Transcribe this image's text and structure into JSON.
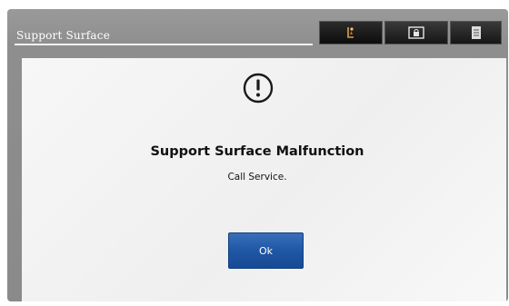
{
  "dialog": {
    "title": "Support Surface",
    "heading": "Support Surface Malfunction",
    "message": "Call Service.",
    "ok_label": "Ok"
  },
  "tabs": [
    {
      "icon": "bed-person-icon",
      "active": true
    },
    {
      "icon": "lock-screen-icon",
      "active": false
    },
    {
      "icon": "notepad-icon",
      "active": false
    }
  ],
  "colors": {
    "frame": "#8e8e8e",
    "panel": "#f3f3f3",
    "tab": "#161616",
    "ok_button": "#1f57a6",
    "tab_accent": "#d9a24a"
  },
  "icons": {
    "alert": "exclamation-circle-icon"
  }
}
